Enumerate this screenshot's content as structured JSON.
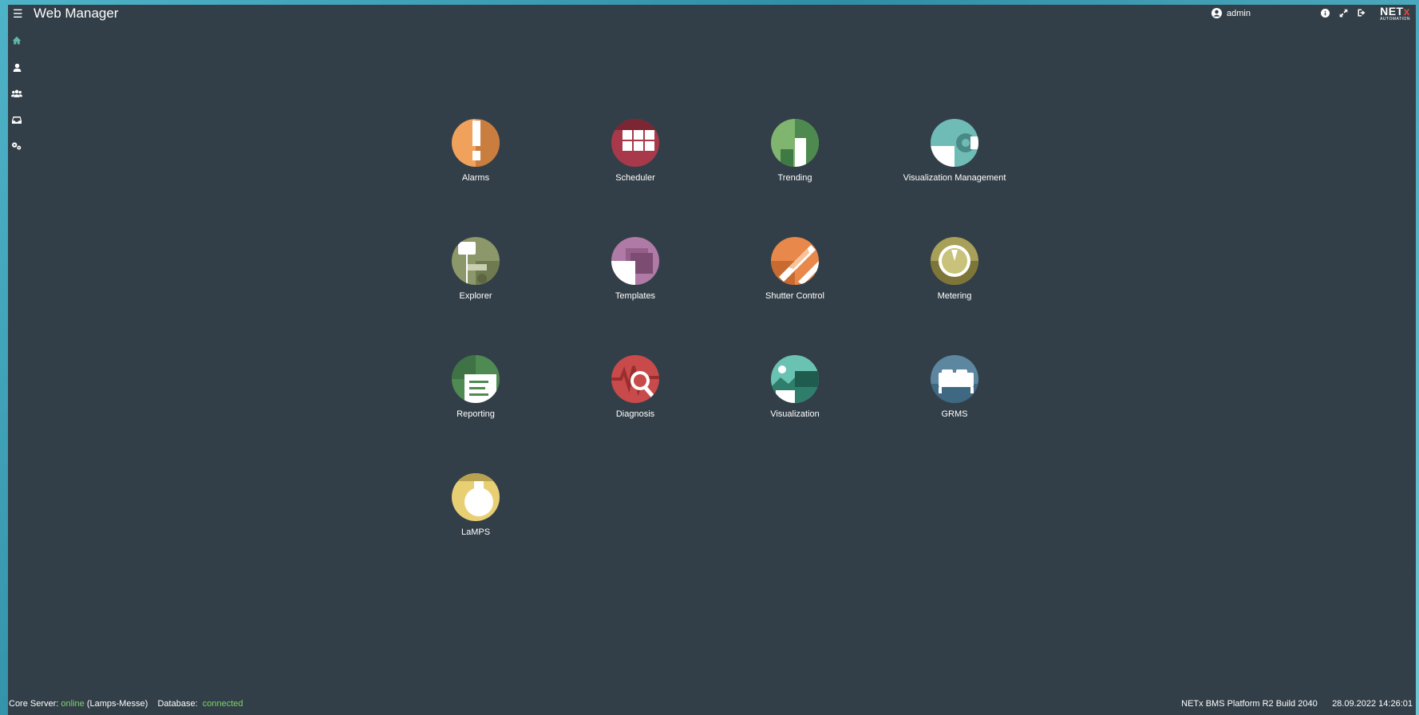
{
  "header": {
    "title": "Web Manager",
    "menu_icon": "hamburger-icon",
    "user": "admin",
    "user_icon": "user-circle-icon",
    "icons": [
      "info-icon",
      "fullscreen-icon",
      "logout-icon"
    ],
    "brand": {
      "main": "NET",
      "accent": "x",
      "sub": "AUTOMATION"
    }
  },
  "sidebar": {
    "items": [
      {
        "icon": "home-icon",
        "active": true
      },
      {
        "icon": "user-icon"
      },
      {
        "icon": "users-icon"
      },
      {
        "icon": "inbox-icon"
      },
      {
        "icon": "gears-icon"
      }
    ]
  },
  "tiles": [
    {
      "label": "Alarms",
      "icon": "alarms-icon",
      "color": "#f0a25c"
    },
    {
      "label": "Scheduler",
      "icon": "scheduler-icon",
      "color": "#a8394a"
    },
    {
      "label": "Trending",
      "icon": "trending-icon",
      "color": "#5f9b5a"
    },
    {
      "label": "Visualization Management",
      "icon": "visualization-management-icon",
      "color": "#6fbcb7"
    },
    {
      "label": "Explorer",
      "icon": "explorer-icon",
      "color": "#8c976a"
    },
    {
      "label": "Templates",
      "icon": "templates-icon",
      "color": "#b07aa6"
    },
    {
      "label": "Shutter Control",
      "icon": "shutter-control-icon",
      "color": "#e8884a"
    },
    {
      "label": "Metering",
      "icon": "metering-icon",
      "color": "#a8a058"
    },
    {
      "label": "Reporting",
      "icon": "reporting-icon",
      "color": "#4e8a52"
    },
    {
      "label": "Diagnosis",
      "icon": "diagnosis-icon",
      "color": "#c84a4a"
    },
    {
      "label": "Visualization",
      "icon": "visualization-icon",
      "color": "#6ac3b2"
    },
    {
      "label": "GRMS",
      "icon": "grms-icon",
      "color": "#5d86a0"
    },
    {
      "label": "LaMPS",
      "icon": "lamps-icon",
      "color": "#e8cf74"
    }
  ],
  "status": {
    "core_label": "Core Server:",
    "core_state": "online",
    "core_host": "(Lamps-Messe)",
    "db_label": "Database:",
    "db_state": "connected",
    "build": "NETx BMS Platform R2 Build 2040",
    "datetime": "28.09.2022 14:26:01"
  },
  "colors": {
    "background": "#333f48",
    "ok": "#7fd36b",
    "brand_accent": "#e5483c"
  }
}
